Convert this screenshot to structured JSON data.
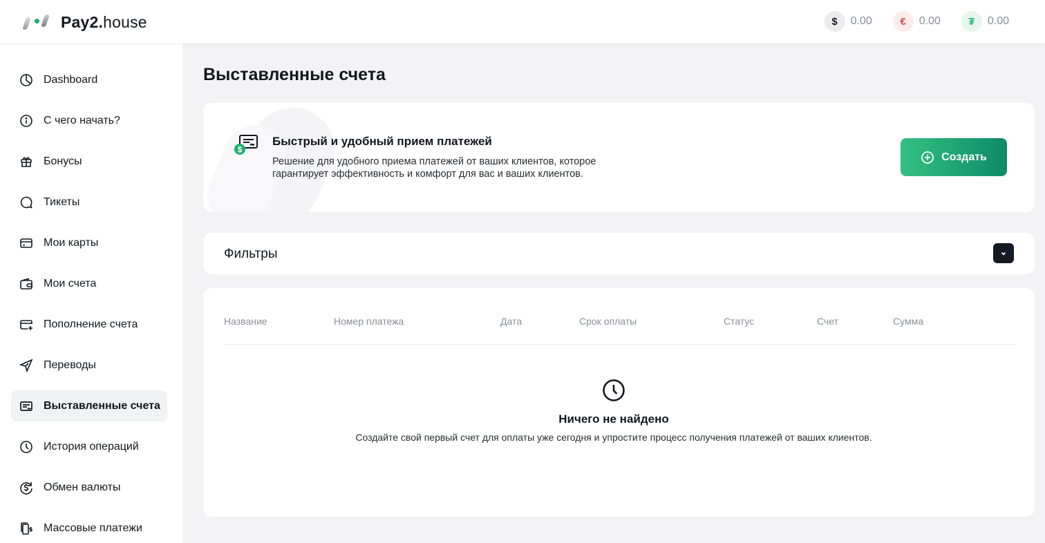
{
  "header": {
    "logo_bold": "Pay2.",
    "logo_light": "house",
    "balances": [
      {
        "symbol": "$",
        "icon": "dollar-icon",
        "value": "0.00"
      },
      {
        "symbol": "€",
        "icon": "euro-icon",
        "value": "0.00"
      },
      {
        "symbol": "₮",
        "icon": "tether-icon",
        "value": "0.00"
      }
    ]
  },
  "sidebar": {
    "items": [
      {
        "label": "Dashboard",
        "icon": "pie-chart-icon"
      },
      {
        "label": "С чего начать?",
        "icon": "info-icon"
      },
      {
        "label": "Бонусы",
        "icon": "gift-icon"
      },
      {
        "label": "Тикеты",
        "icon": "chat-icon"
      },
      {
        "label": "Мои карты",
        "icon": "card-icon"
      },
      {
        "label": "Мои счета",
        "icon": "wallet-icon"
      },
      {
        "label": "Пополнение счета",
        "icon": "card-add-icon"
      },
      {
        "label": "Переводы",
        "icon": "send-icon"
      },
      {
        "label": "Выставленные счета",
        "icon": "invoice-icon",
        "active": true
      },
      {
        "label": "История операций",
        "icon": "clock-icon"
      },
      {
        "label": "Обмен валюты",
        "icon": "exchange-icon"
      },
      {
        "label": "Массовые платежи",
        "icon": "mass-payments-icon"
      }
    ]
  },
  "main": {
    "title": "Выставленные счета",
    "promo": {
      "title": "Быстрый и удобный прием платежей",
      "description": "Решение для удобного приема платежей от ваших клиентов, которое гарантирует эффективность и комфорт для вас и ваших клиентов.",
      "create_label": "Создать"
    },
    "filters": {
      "label": "Фильтры"
    },
    "table": {
      "columns": [
        "Название",
        "Номер платежа",
        "Дата",
        "Срок оплаты",
        "Статус",
        "Счет",
        "Сумма"
      ],
      "rows": [],
      "empty_title": "Ничего не найдено",
      "empty_description": "Создайте свой первый счет для оплаты уже сегодня и упростите процесс получения платежей от ваших клиентов."
    }
  },
  "colors": {
    "accent_gradient_start": "#33c183",
    "accent_gradient_end": "#0e8a66",
    "dark": "#161a24",
    "background": "#f3f3f5"
  }
}
